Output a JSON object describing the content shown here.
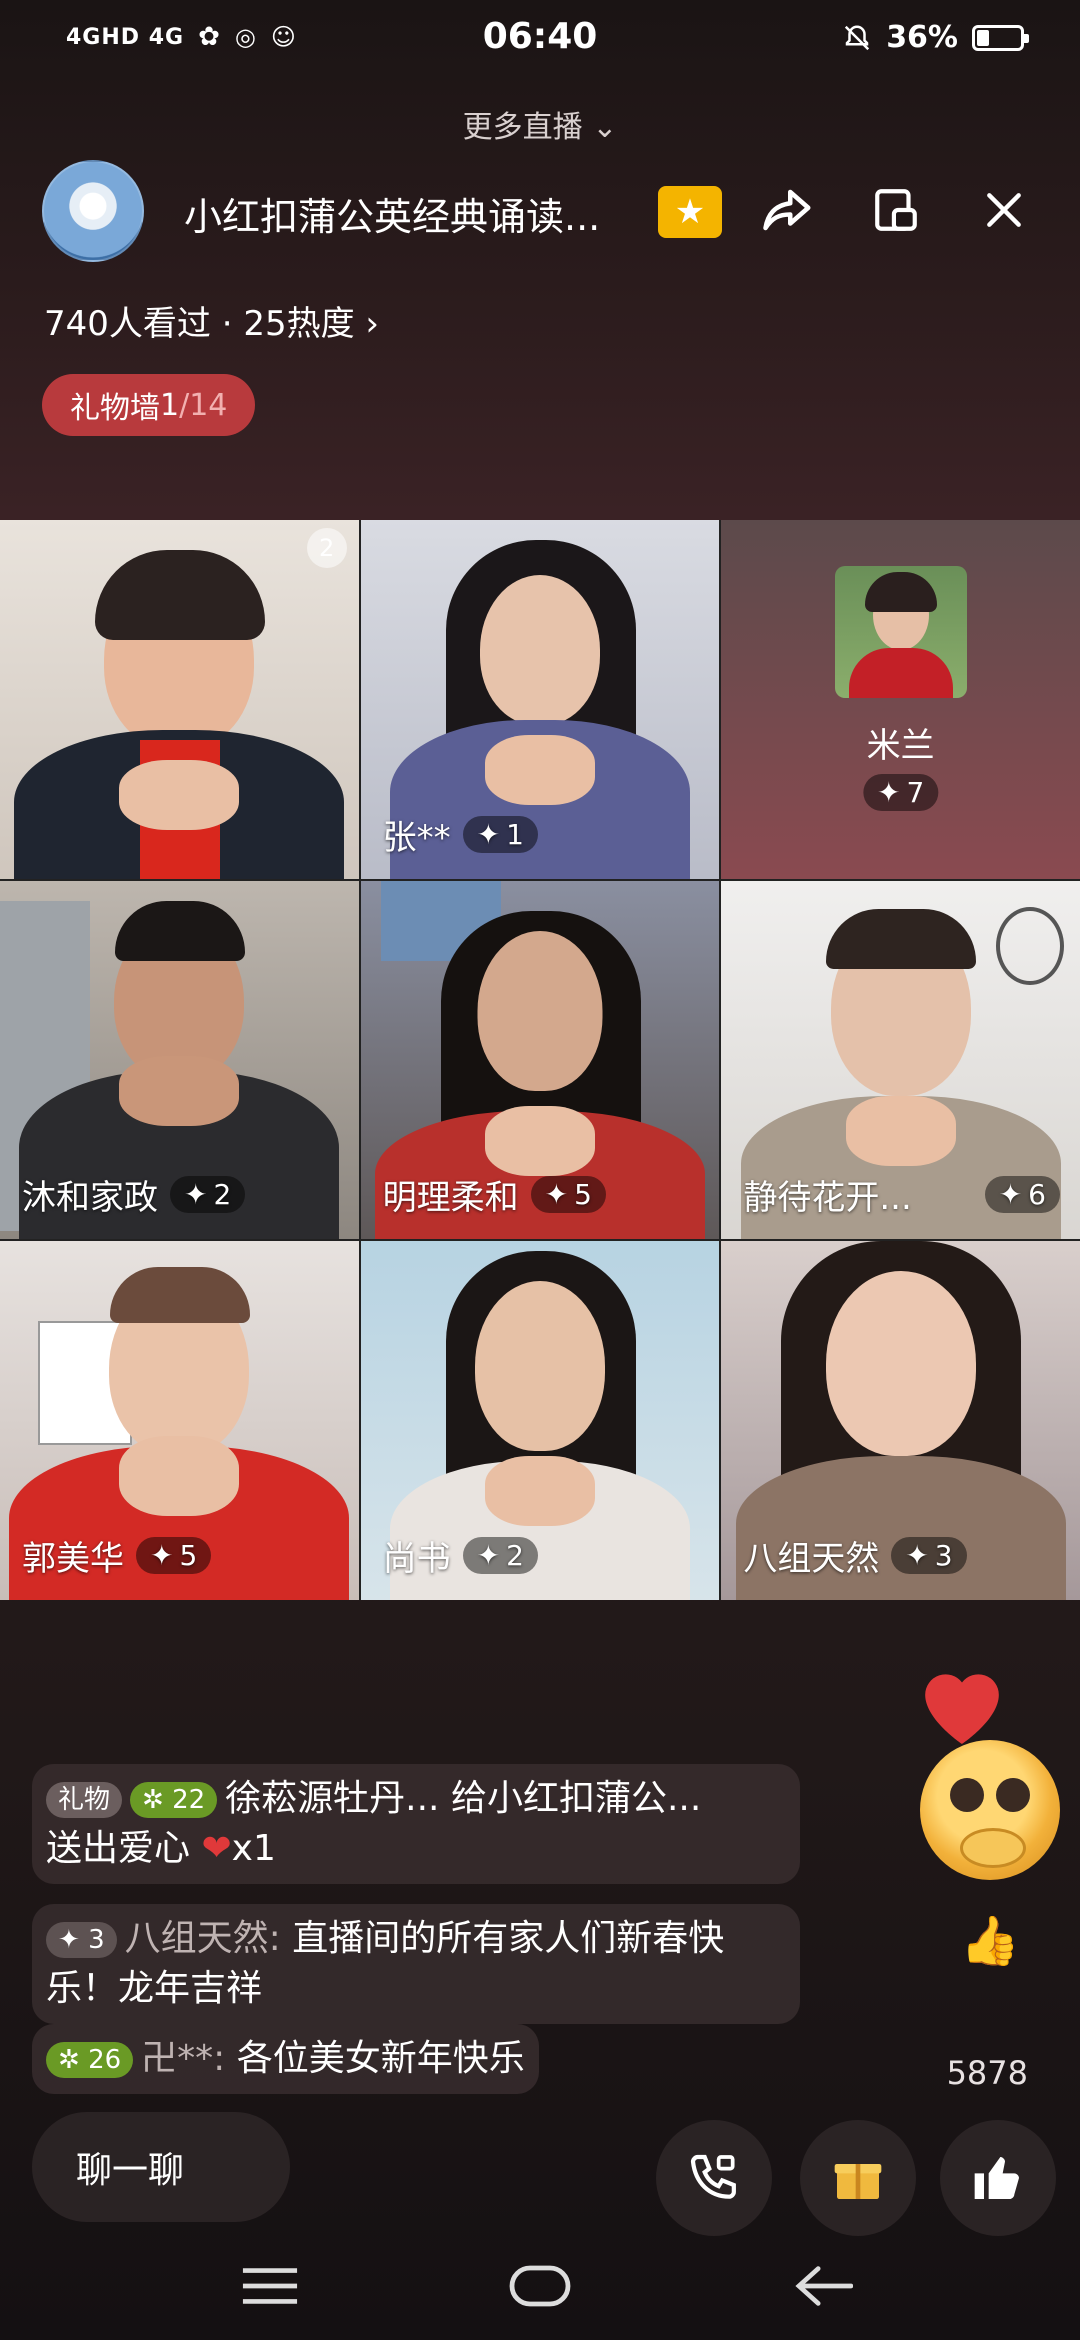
{
  "status_bar": {
    "network_left": "4GHD 4G",
    "time": "06:40",
    "battery_pct": "36%",
    "battery_level": 0.36
  },
  "more_live": "更多直播",
  "header": {
    "host_title": "小红扣蒲公英经典诵读...",
    "stats": "740人看过 · 25热度",
    "gift_wall_label": "礼物墙 ",
    "gift_wall_current": "1",
    "gift_wall_total": "/14"
  },
  "tiles": [
    {
      "name": "",
      "score": "",
      "badge": "2"
    },
    {
      "name": "张**",
      "score": "1"
    },
    {
      "name": "米兰",
      "score": "7"
    },
    {
      "name": "沐和家政",
      "score": "2"
    },
    {
      "name": "明理柔和",
      "score": "5"
    },
    {
      "name": "静待花开...",
      "score": "6"
    },
    {
      "name": "郭美华",
      "score": "5"
    },
    {
      "name": "尚书",
      "score": "2"
    },
    {
      "name": "八组天然",
      "score": "3"
    }
  ],
  "chat": [
    {
      "chip_gift": "礼物",
      "level": "22",
      "text_line1": "徐菘源牡丹... 给小红扣蒲公...",
      "text_line2": "送出爱心",
      "gift_count": "x1"
    },
    {
      "level": "3",
      "user": "八组天然:",
      "text": "直播间的所有家人们新春快乐！龙年吉祥"
    },
    {
      "level": "26",
      "user": "卍**:",
      "text": "各位美女新年快乐"
    }
  ],
  "like_count": "5878",
  "bottom": {
    "chat_placeholder": "聊一聊"
  },
  "icons": [
    "signal-icon",
    "wechat-icon",
    "mute-icon",
    "share-icon",
    "pip-icon",
    "close-icon",
    "video-call-icon",
    "gift-icon",
    "thumb-up-icon",
    "menu-icon",
    "home-icon",
    "back-icon"
  ],
  "colors": {
    "gift_wall": "#b83a3d",
    "level_badge": "#6a9a25",
    "favorite": "#f4b400"
  }
}
